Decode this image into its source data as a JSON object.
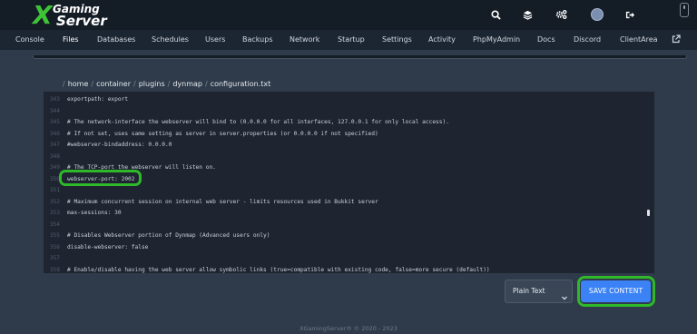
{
  "brand": {
    "logo_mark": "X",
    "logo_line1": "Gaming",
    "logo_line2": "Server"
  },
  "topbar_icons": [
    "search-icon",
    "layers-icon",
    "cogs-icon",
    "avatar",
    "logout-icon"
  ],
  "nav": {
    "items": [
      {
        "label": "Console"
      },
      {
        "label": "Files",
        "active": true
      },
      {
        "label": "Databases"
      },
      {
        "label": "Schedules"
      },
      {
        "label": "Users"
      },
      {
        "label": "Backups"
      },
      {
        "label": "Network"
      },
      {
        "label": "Startup"
      },
      {
        "label": "Settings"
      },
      {
        "label": "Activity"
      },
      {
        "label": "PhpMyAdmin"
      },
      {
        "label": "Docs"
      },
      {
        "label": "Discord"
      },
      {
        "label": "ClientArea"
      }
    ]
  },
  "breadcrumb": {
    "root": "/",
    "segments": [
      "home",
      "container",
      "plugins",
      "dynmap",
      "configuration.txt"
    ]
  },
  "editor": {
    "lines": [
      {
        "num": "343",
        "text": "exportpath: export"
      },
      {
        "num": "344",
        "text": ""
      },
      {
        "num": "345",
        "text": "# The network-interface the webserver will bind to (0.0.0.0 for all interfaces, 127.0.0.1 for only local access)."
      },
      {
        "num": "346",
        "text": "# If not set, uses same setting as server in server.properties (or 0.0.0.0 if not specified)"
      },
      {
        "num": "347",
        "text": "#webserver-bindaddress: 0.0.0.0"
      },
      {
        "num": "348",
        "text": ""
      },
      {
        "num": "349",
        "text": "# The TCP-port the webserver will listen on."
      },
      {
        "num": "350",
        "text": "webserver-port: 2002"
      },
      {
        "num": "351",
        "text": ""
      },
      {
        "num": "352",
        "text": "# Maximum concurrent session on internal web server - limits resources used in Bukkit server"
      },
      {
        "num": "353",
        "text": "max-sessions: 30"
      },
      {
        "num": "354",
        "text": ""
      },
      {
        "num": "355",
        "text": "# Disables Webserver portion of Dynmap (Advanced users only)"
      },
      {
        "num": "356",
        "text": "disable-webserver: false"
      },
      {
        "num": "357",
        "text": ""
      },
      {
        "num": "358",
        "text": "# Enable/disable having the web server allow symbolic links (true=compatible with existing code, false=more secure (default))"
      }
    ]
  },
  "mode_select": {
    "value": "Plain Text"
  },
  "save_button": {
    "label": "SAVE CONTENT"
  },
  "footer": {
    "text": "XGamingServer® © 2020 - 2023"
  },
  "colors": {
    "accent_green": "#2fb82a",
    "primary_blue": "#3b82f6",
    "background": "#2f3b4a",
    "editor_bg": "#1e2530",
    "topbar_bg": "#141c26"
  }
}
